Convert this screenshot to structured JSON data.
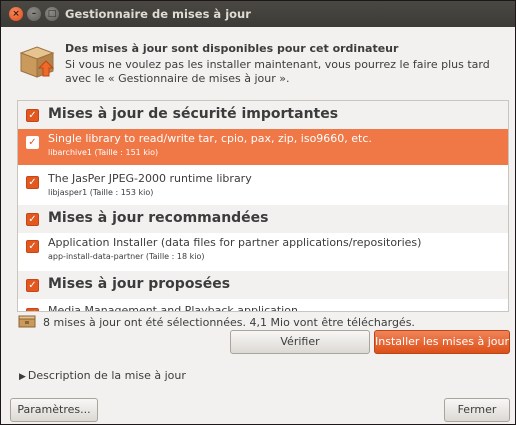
{
  "window": {
    "title": "Gestionnaire de mises à jour",
    "close_glyph": "×",
    "min_glyph": "–",
    "max_glyph": "□"
  },
  "header": {
    "icon": "package-update-icon",
    "title": "Des mises à jour sont disponibles pour cet ordinateur",
    "description": "Si vous ne voulez pas les installer maintenant, vous pourrez le faire plus tard avec le « Gestionnaire de mises à jour »."
  },
  "updates": {
    "groups": [
      {
        "title": "Mises à jour de sécurité importantes",
        "checked": true
      },
      {
        "title": "Mises à jour recommandées",
        "checked": true
      },
      {
        "title": "Mises à jour proposées",
        "checked": true
      }
    ],
    "items": [
      {
        "name": "Single library to read/write tar, cpio, pax, zip, iso9660, etc.",
        "size": "libarchive1 (Taille : 151 kio)",
        "checked": true,
        "selected": true
      },
      {
        "name": "The JasPer JPEG-2000 runtime library",
        "size": "libjasper1 (Taille : 153 kio)",
        "checked": true,
        "selected": false
      },
      {
        "name": "Application Installer (data files for partner applications/repositories)",
        "size": "app-install-data-partner (Taille : 18 kio)",
        "checked": true,
        "selected": false
      },
      {
        "name": "Media Management and Playback application",
        "size": "",
        "checked": true,
        "selected": false
      }
    ],
    "check_glyph": "✓"
  },
  "status": {
    "text": "8 mises à jour ont été sélectionnées. 4,1 Mio vont être téléchargés."
  },
  "buttons": {
    "check": "Vérifier",
    "install": "Installer les mises à jour",
    "settings": "Paramètres...",
    "close": "Fermer"
  },
  "expander": {
    "arrow": "▶",
    "label": "Description de la mise à jour"
  },
  "colors": {
    "accent": "#e2581f",
    "selection": "#f07746",
    "titlebar": "#3c3b37"
  }
}
